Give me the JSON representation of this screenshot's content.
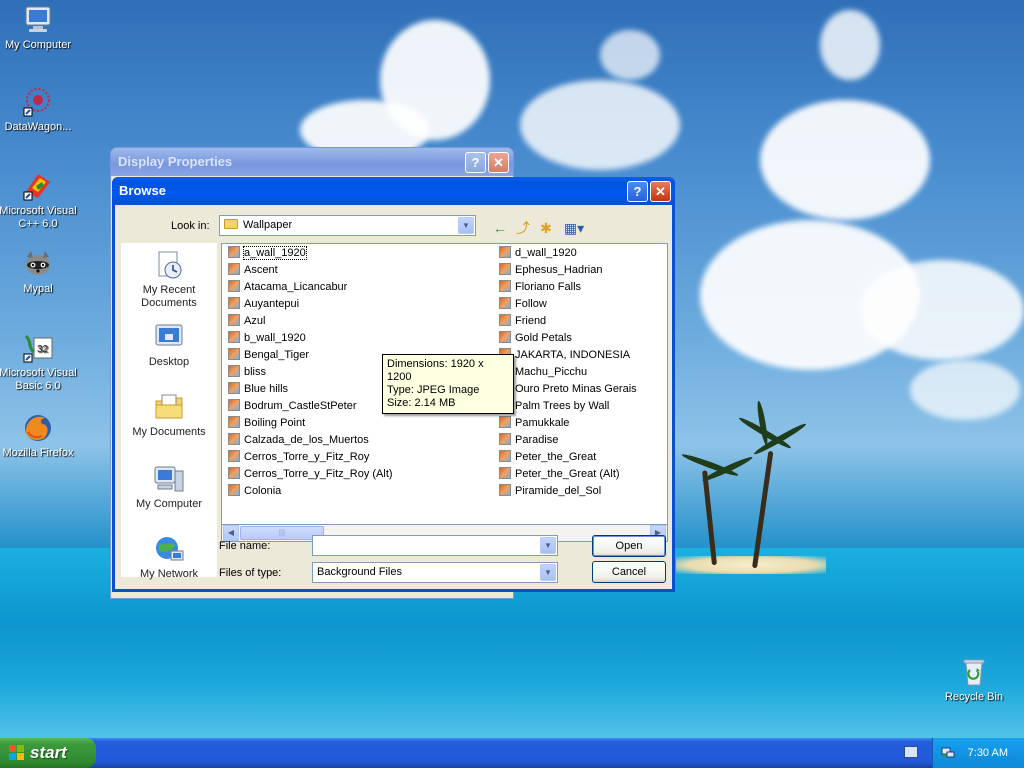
{
  "desktop": {
    "icons": [
      {
        "label": "My Computer",
        "icon": "monitor-icon"
      },
      {
        "label": "DataWagon...",
        "icon": "datawagon-icon"
      },
      {
        "label": "Microsoft Visual C++ 6.0",
        "icon": "visual-cpp-icon"
      },
      {
        "label": "Mypal",
        "icon": "raccoon-icon"
      },
      {
        "label": "Microsoft Visual Basic 6.0",
        "icon": "visual-basic-icon"
      },
      {
        "label": "Mozilla Firefox",
        "icon": "firefox-icon"
      },
      {
        "label": "Recycle Bin",
        "icon": "recycle-bin-icon"
      }
    ]
  },
  "display_properties": {
    "title": "Display Properties",
    "help_glyph": "?",
    "close_glyph": "✕"
  },
  "browse": {
    "title": "Browse",
    "help_glyph": "?",
    "close_glyph": "✕",
    "look_in_label": "Look in:",
    "look_in_value": "Wallpaper",
    "toolbar": {
      "back": "←",
      "up": "⤴",
      "new_folder": "✱",
      "views": "▦▾"
    },
    "places": [
      {
        "label": "My Recent Documents",
        "icon": "recent-documents-icon"
      },
      {
        "label": "Desktop",
        "icon": "desktop-icon"
      },
      {
        "label": "My Documents",
        "icon": "my-documents-icon"
      },
      {
        "label": "My Computer",
        "icon": "my-computer-icon"
      },
      {
        "label": "My Network",
        "icon": "my-network-icon"
      }
    ],
    "files_col1": [
      "a_wall_1920",
      "Ascent",
      "Atacama_Licancabur",
      "Auyantepui",
      "Azul",
      "b_wall_1920",
      "Bengal_Tiger",
      "bliss",
      "Blue hills",
      "Bodrum_CastleStPeter",
      "Boiling Point",
      "Calzada_de_los_Muertos",
      "Cerros_Torre_y_Fitz_Roy",
      "Cerros_Torre_y_Fitz_Roy (Alt)",
      "Colonia"
    ],
    "files_col2": [
      "d_wall_1920",
      "Ephesus_Hadrian",
      "Floriano Falls",
      "Follow",
      "Friend",
      "Gold Petals",
      "JAKARTA, INDONESIA",
      "Machu_Picchu",
      "Ouro Preto Minas Gerais",
      "Palm Trees by Wall",
      "Pamukkale",
      "Paradise",
      "Peter_the_Great",
      "Peter_the_Great (Alt)",
      "Piramide_del_Sol"
    ],
    "tooltip": {
      "dimensions": "Dimensions: 1920 x 1200",
      "type": "Type: JPEG Image",
      "size": "Size: 2.14 MB"
    },
    "file_name_label": "File name:",
    "file_name_value": "",
    "files_of_type_label": "Files of type:",
    "files_of_type_value": "Background Files",
    "open_label": "Open",
    "cancel_label": "Cancel"
  },
  "taskbar": {
    "start_label": "start",
    "clock": "7:30 AM"
  }
}
